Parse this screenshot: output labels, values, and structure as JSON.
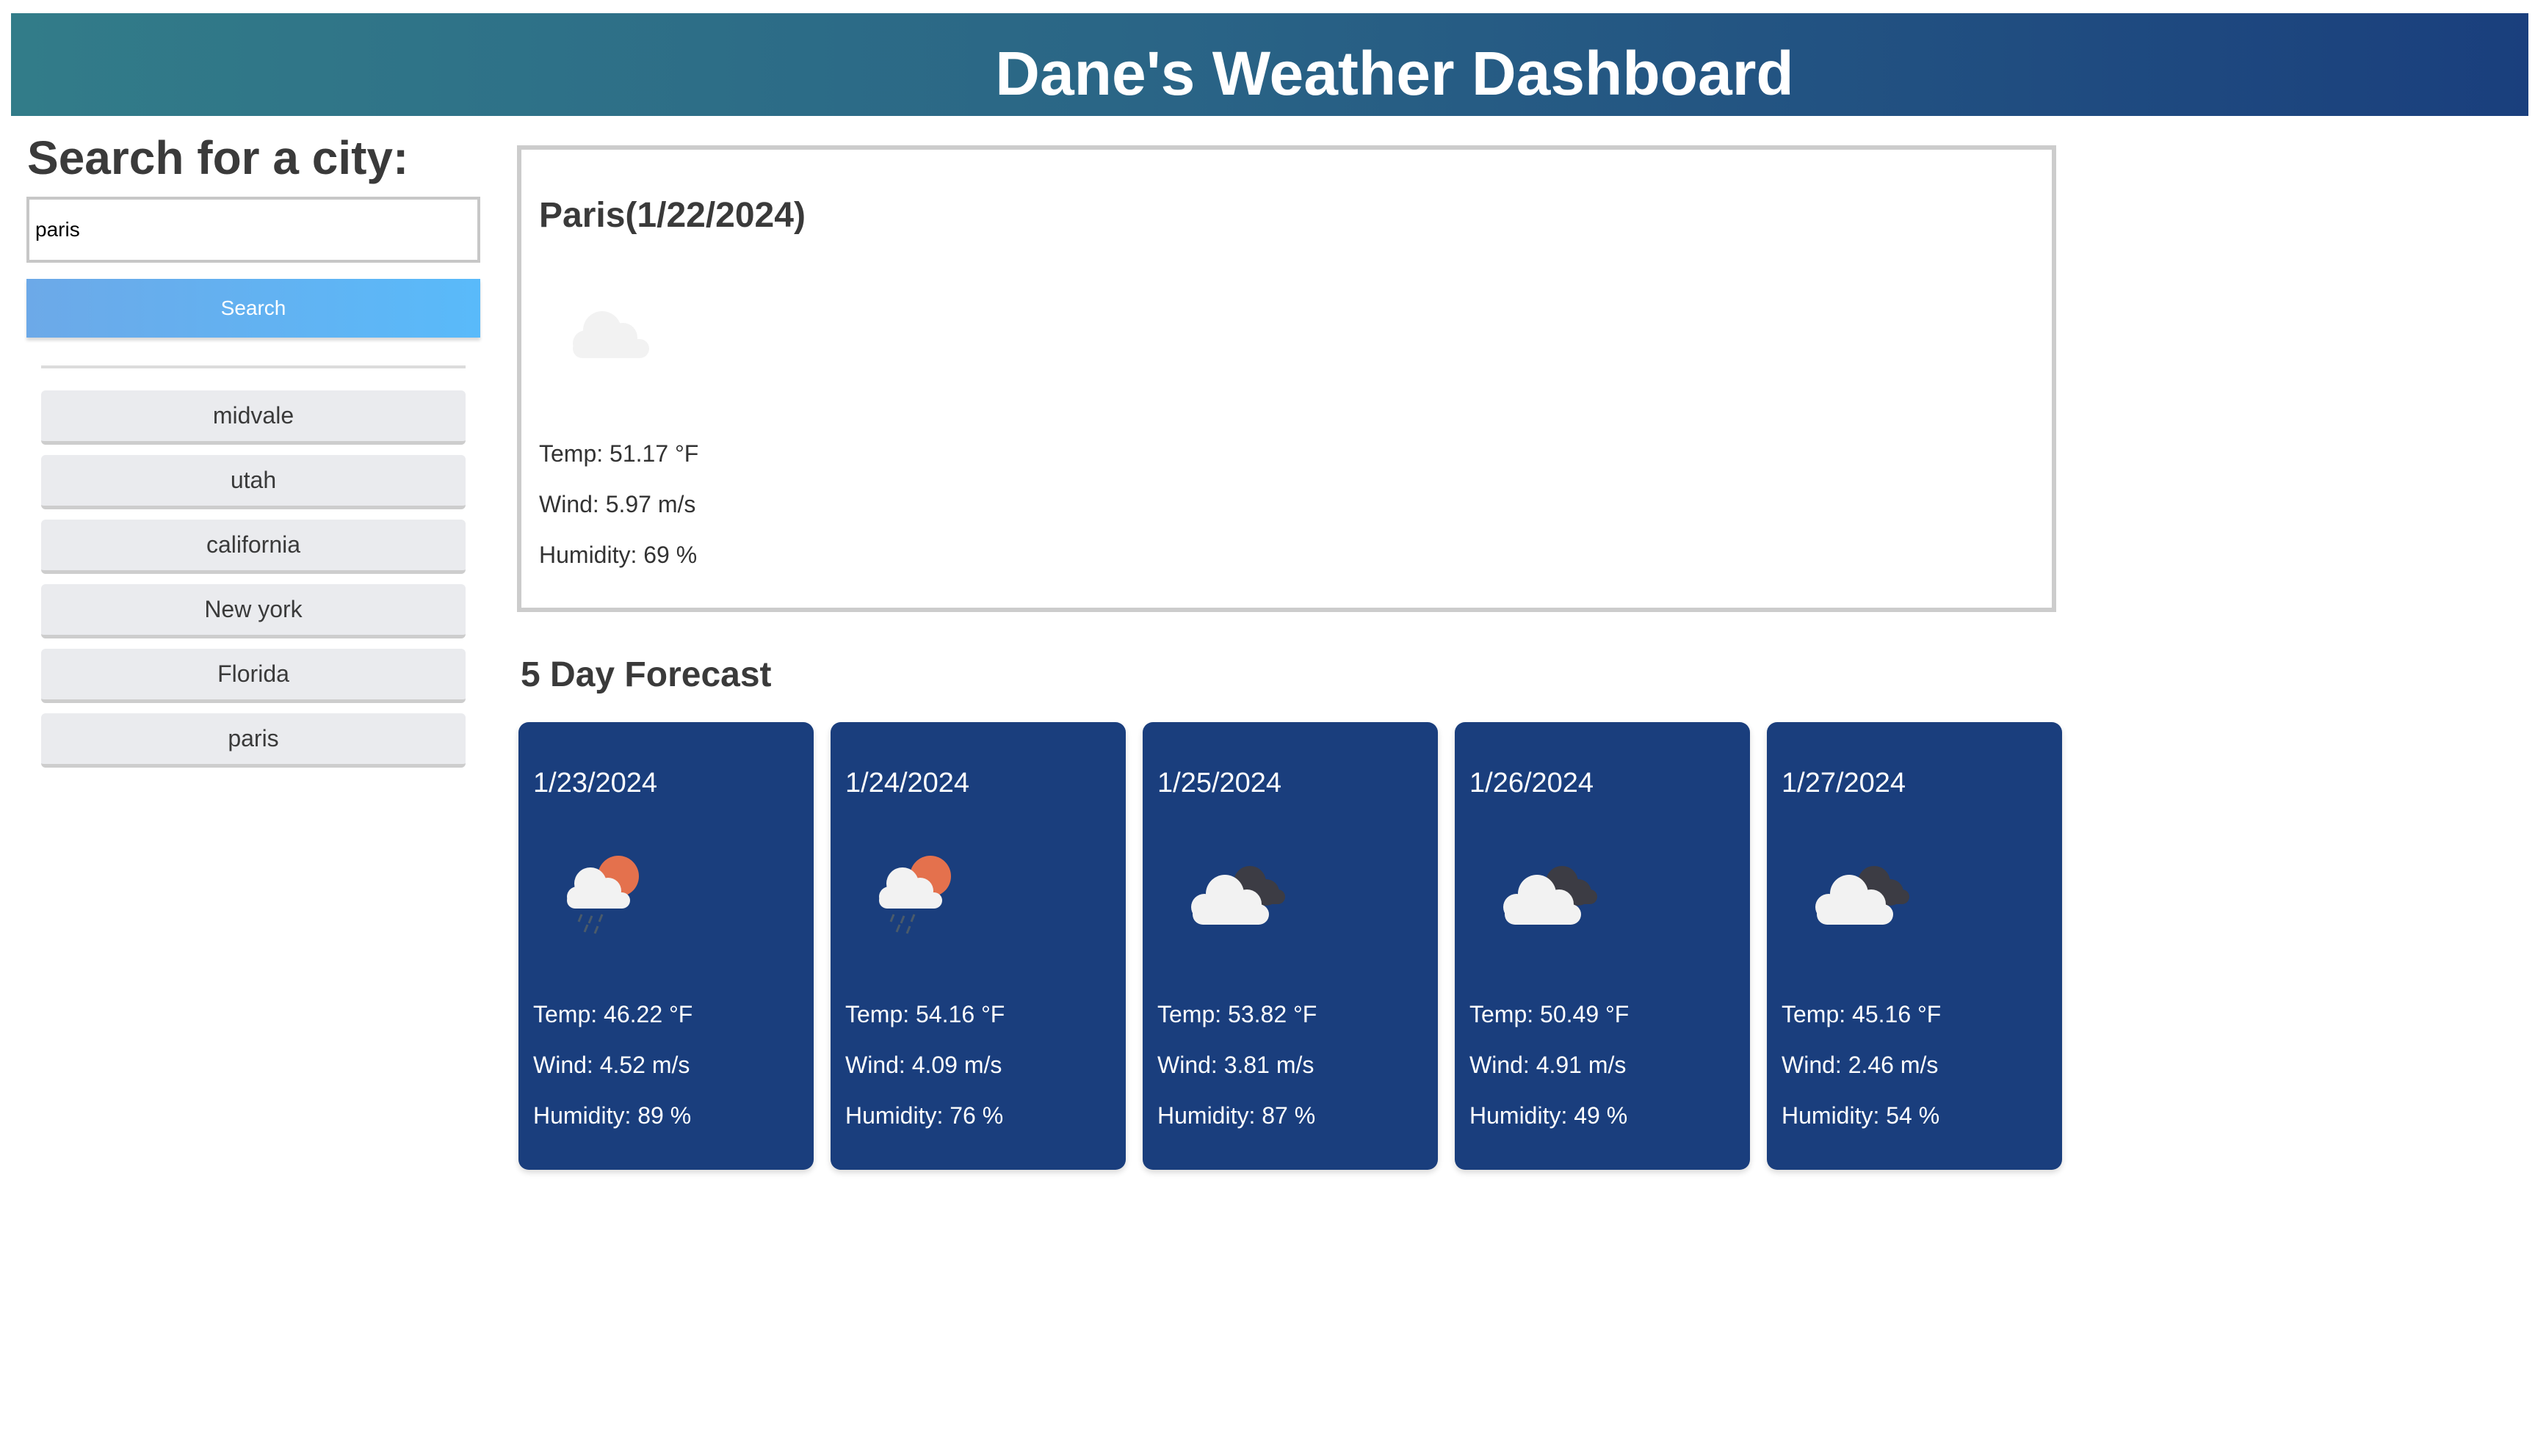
{
  "header": {
    "title": "Dane's Weather Dashboard"
  },
  "search": {
    "heading": "Search for a city:",
    "value": "paris",
    "button_label": "Search"
  },
  "history": [
    "midvale",
    "utah",
    "california",
    "New york",
    "Florida",
    "paris"
  ],
  "current": {
    "city_date": "Paris(1/22/2024)",
    "icon": "cloud-icon",
    "temp": "Temp: 51.17 °F",
    "wind": "Wind: 5.97 m/s",
    "humidity": "Humidity: 69 %"
  },
  "forecast": {
    "heading": "5 Day Forecast",
    "days": [
      {
        "date": "1/23/2024",
        "icon": "rain-sun-cloud-icon",
        "temp": "Temp: 46.22 °F",
        "wind": "Wind: 4.52 m/s",
        "humidity": "Humidity: 89 %"
      },
      {
        "date": "1/24/2024",
        "icon": "rain-sun-cloud-icon",
        "temp": "Temp: 54.16 °F",
        "wind": "Wind: 4.09 m/s",
        "humidity": "Humidity: 76 %"
      },
      {
        "date": "1/25/2024",
        "icon": "broken-clouds-icon",
        "temp": "Temp: 53.82 °F",
        "wind": "Wind: 3.81 m/s",
        "humidity": "Humidity: 87 %"
      },
      {
        "date": "1/26/2024",
        "icon": "broken-clouds-icon",
        "temp": "Temp: 50.49 °F",
        "wind": "Wind: 4.91 m/s",
        "humidity": "Humidity: 49 %"
      },
      {
        "date": "1/27/2024",
        "icon": "broken-clouds-icon",
        "temp": "Temp: 45.16 °F",
        "wind": "Wind: 2.46 m/s",
        "humidity": "Humidity: 54 %"
      }
    ]
  },
  "colors": {
    "header_start": "#327c89",
    "header_end": "#1a3f7d",
    "card_bg": "#1a3e7d",
    "button_start": "#6ca9e8",
    "button_end": "#59bafa",
    "sun": "#e4714d"
  }
}
